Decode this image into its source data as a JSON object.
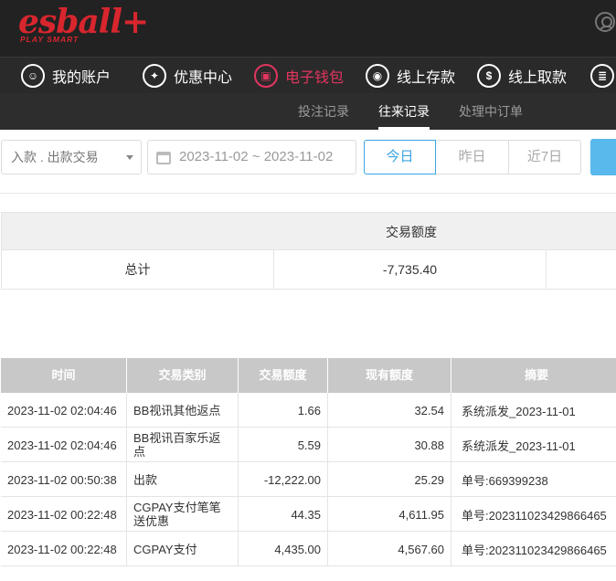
{
  "brand": {
    "logo": "esball+",
    "tagline": "PLAY SMART"
  },
  "nav": [
    {
      "label": "我的账户",
      "icon": "user-icon",
      "glyph": "☺"
    },
    {
      "label": "优惠中心",
      "icon": "gift-icon",
      "glyph": "✦"
    },
    {
      "label": "电子钱包",
      "icon": "wallet-icon",
      "glyph": "▣"
    },
    {
      "label": "线上存款",
      "icon": "deposit-icon",
      "glyph": "◉"
    },
    {
      "label": "线上取款",
      "icon": "withdraw-icon",
      "glyph": "$"
    },
    {
      "label": "",
      "icon": "statement-icon",
      "glyph": "≣"
    }
  ],
  "active_nav": "电子钱包",
  "subnav": [
    {
      "label": "投注记录"
    },
    {
      "label": "往来记录"
    },
    {
      "label": "处理中订单"
    }
  ],
  "filters": {
    "type_select": "入款 . 出款交易",
    "date_range": "2023-11-02 ~ 2023-11-02",
    "quick": {
      "today": "今日",
      "yesterday": "昨日",
      "last7": "近7日"
    }
  },
  "summary": {
    "header": "交易额度",
    "row_label": "总计",
    "row_value": "-7,735.40"
  },
  "records": {
    "columns": [
      "时间",
      "交易类别",
      "交易额度",
      "现有额度",
      "摘要"
    ],
    "rows": [
      {
        "time": "2023-11-02 02:04:46",
        "type": "BB视讯其他返点",
        "amount": "1.66",
        "balance": "32.54",
        "note": "系统派发_2023-11-01"
      },
      {
        "time": "2023-11-02 02:04:46",
        "type": "BB视讯百家乐返点",
        "amount": "5.59",
        "balance": "30.88",
        "note": "系统派发_2023-11-01"
      },
      {
        "time": "2023-11-02 00:50:38",
        "type": "出款",
        "amount": "-12,222.00",
        "balance": "25.29",
        "note": "单号:669399238"
      },
      {
        "time": "2023-11-02 00:22:48",
        "type": "CGPAY支付笔笔送优惠",
        "amount": "44.35",
        "balance": "4,611.95",
        "note": "单号:202311023429866465"
      },
      {
        "time": "2023-11-02 00:22:48",
        "type": "CGPAY支付",
        "amount": "4,435.00",
        "balance": "4,567.60",
        "note": "单号:202311023429866465"
      }
    ]
  },
  "colors": {
    "accent": "#e2355f",
    "brand": "#d8262e",
    "link": "#3aa3e3",
    "header_gray": "#c8c8c8"
  }
}
